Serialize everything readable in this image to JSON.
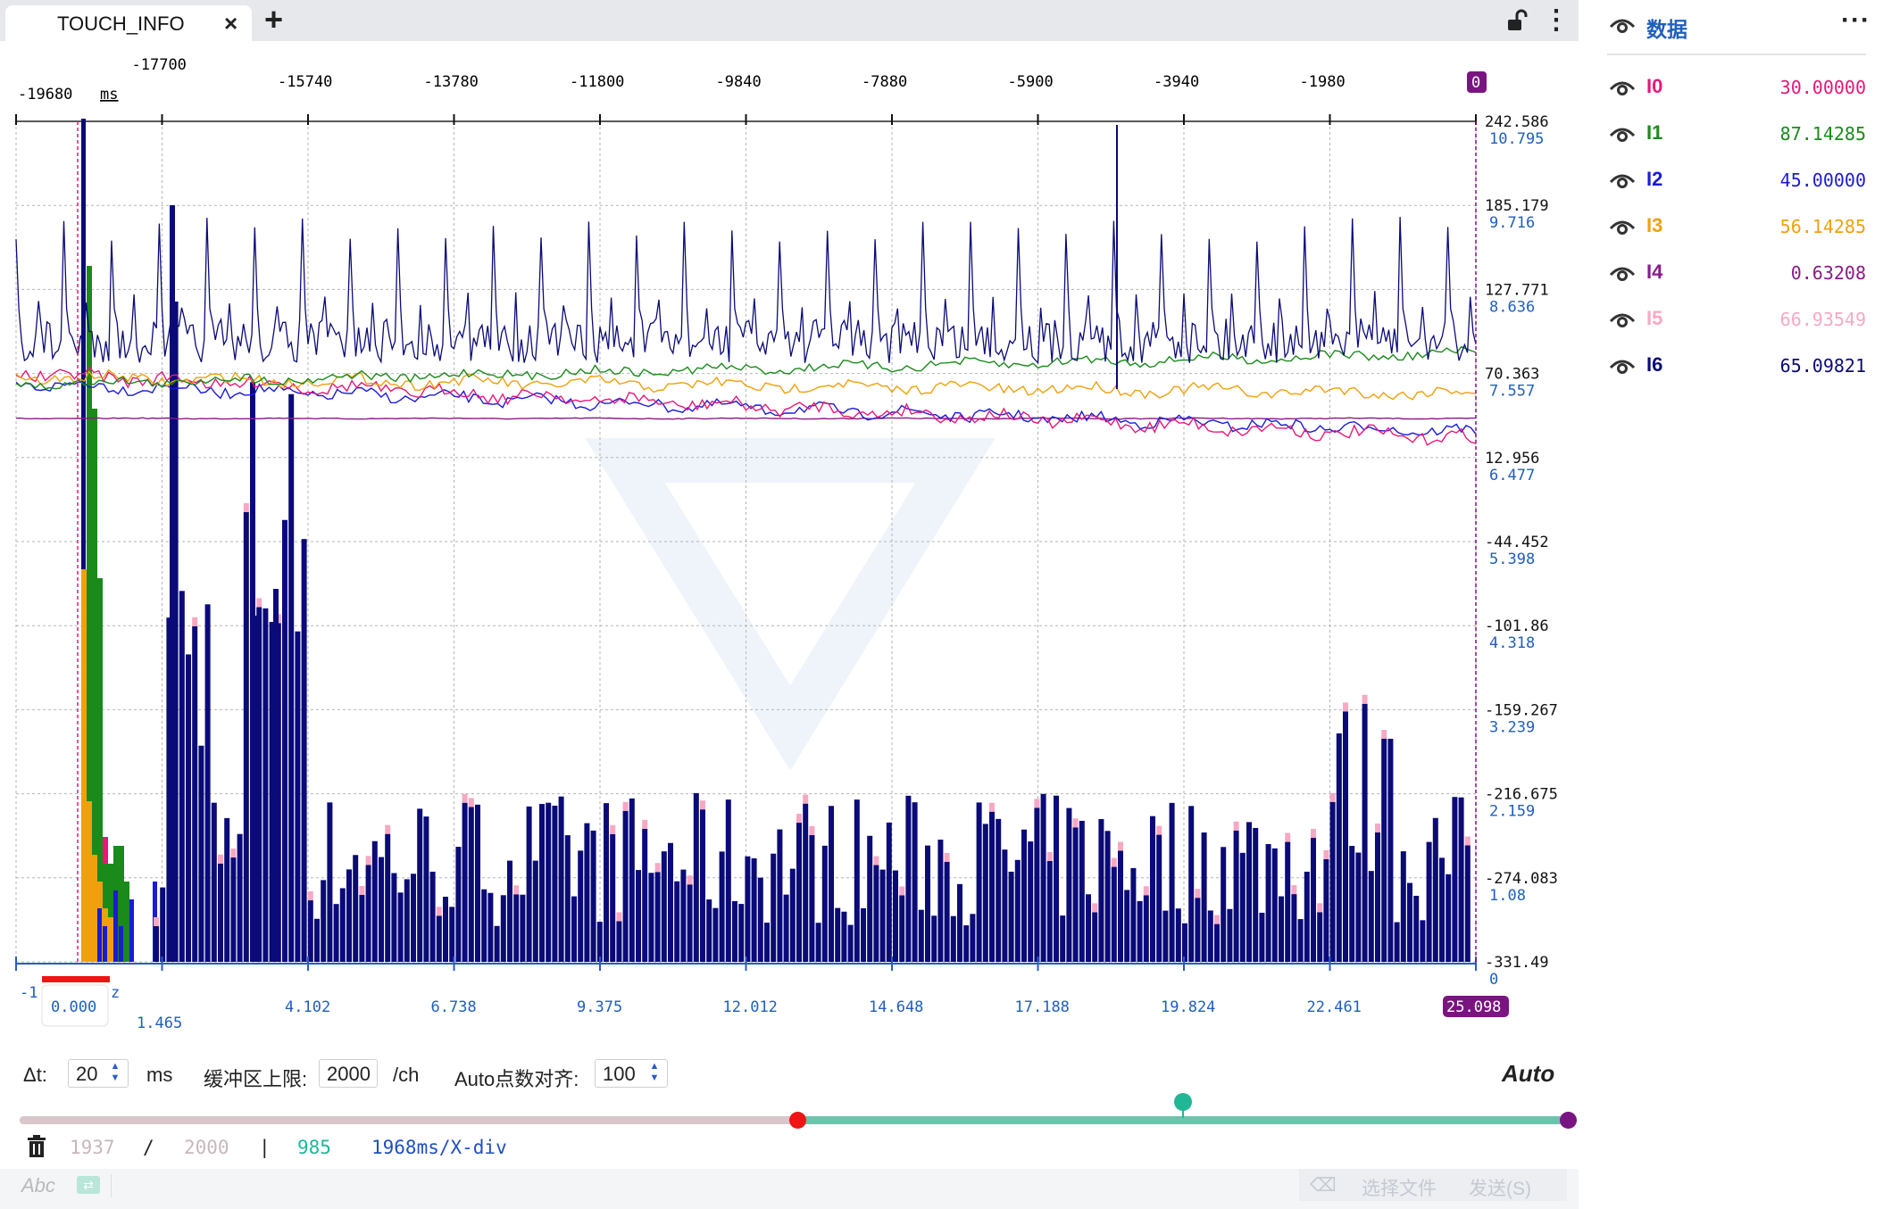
{
  "tab": {
    "title": "TOUCH_INFO",
    "close": "×",
    "add": "+"
  },
  "toolbar": {
    "more": "⋮"
  },
  "chart": {
    "time_ticks": [
      "-19680",
      "-17700",
      "-15740",
      "-13780",
      "-11800",
      "-9840",
      "-7880",
      "-5900",
      "-3940",
      "-1980",
      "0"
    ],
    "time_unit": "ms",
    "y_left_labels": [
      "242.586",
      "185.179",
      "127.771",
      "70.363",
      "12.956",
      "-44.452",
      "-101.86",
      "-159.267",
      "-216.675",
      "-274.083",
      "-331.49"
    ],
    "y_right_labels": [
      "10.795",
      "9.716",
      "8.636",
      "7.557",
      "6.477",
      "5.398",
      "4.318",
      "3.239",
      "2.159",
      "1.08",
      "0"
    ],
    "freq_ticks": [
      "0.000",
      "1.465",
      "4.102",
      "6.738",
      "9.375",
      "12.012",
      "14.648",
      "17.188",
      "19.824",
      "22.461",
      "25.098"
    ],
    "freq_unit": "-1",
    "freq_unit_tail": "z"
  },
  "controls": {
    "dt_label": "Δt:",
    "dt_value": "20",
    "dt_unit": "ms",
    "buffer_label": "缓冲区上限:",
    "buffer_value": "2000",
    "buffer_unit": "/ch",
    "align_label": "Auto点数对齐:",
    "align_value": "100",
    "mode": "Auto"
  },
  "status": {
    "count": "1937",
    "sep": "/",
    "limit": "2000",
    "bar": "|",
    "points": "985",
    "scale": "1968ms/X-div"
  },
  "footer": {
    "abc": "Abc",
    "choose_file": "选择文件",
    "send": "发送(S)"
  },
  "panel": {
    "title": "数据",
    "more": "···",
    "channels": [
      {
        "name": "I0",
        "value": "30.00000",
        "color": "#e8177a"
      },
      {
        "name": "I1",
        "value": "87.14285",
        "color": "#1a8a1a"
      },
      {
        "name": "I2",
        "value": "45.00000",
        "color": "#1b1bd6"
      },
      {
        "name": "I3",
        "value": "56.14285",
        "color": "#f0a00c"
      },
      {
        "name": "I4",
        "value": "0.63208",
        "color": "#8a1a8a"
      },
      {
        "name": "I5",
        "value": "66.93549",
        "color": "#f7a8c4"
      },
      {
        "name": "I6",
        "value": "65.09821",
        "color": "#0a0a78"
      }
    ]
  }
}
